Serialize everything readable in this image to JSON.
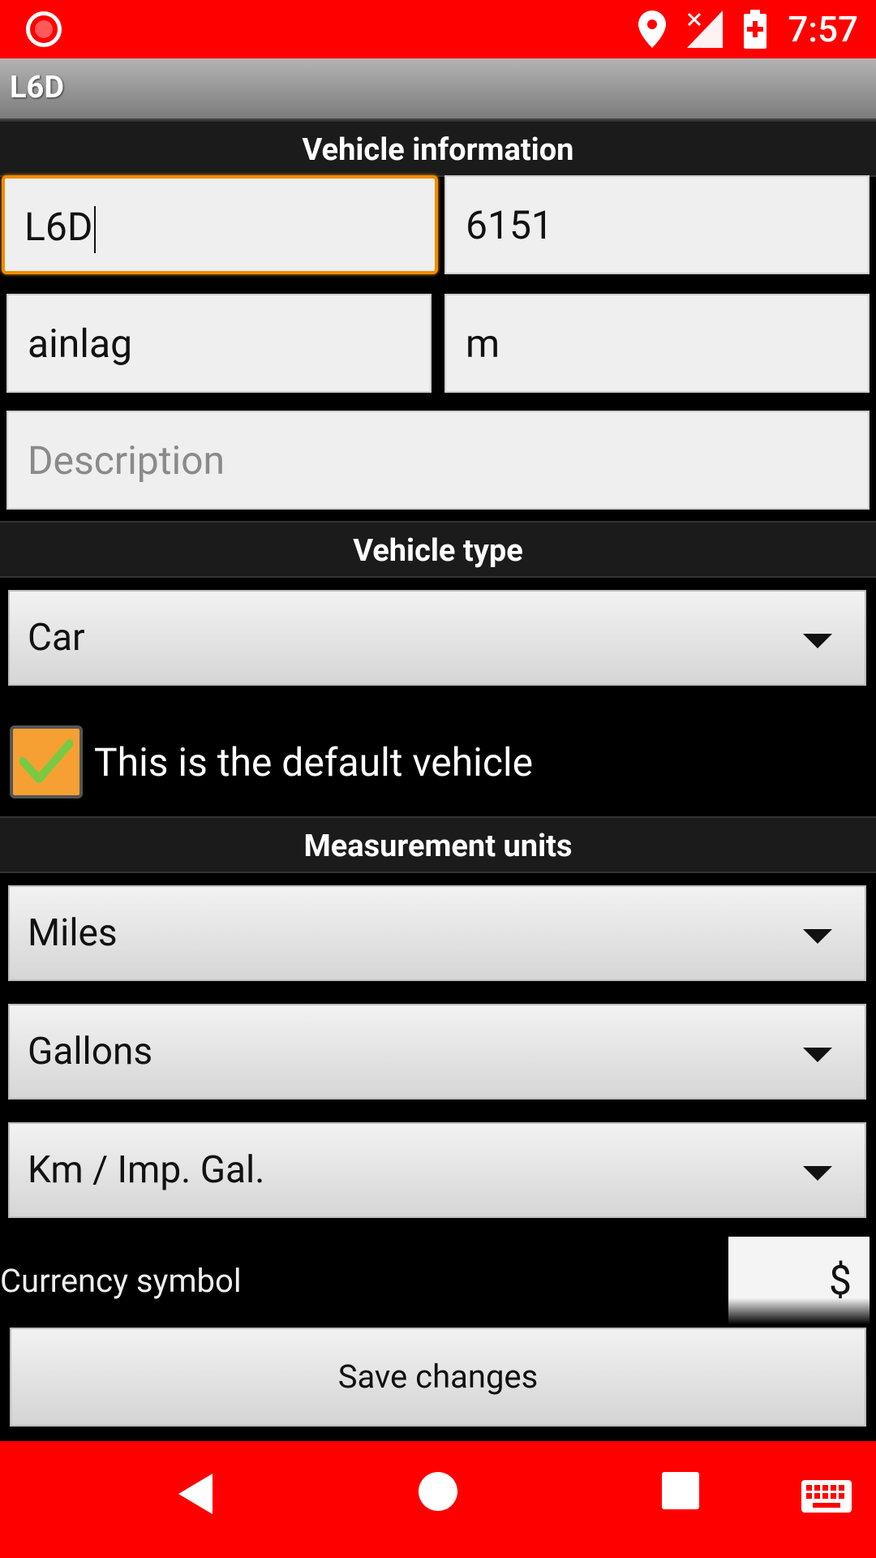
{
  "status_bar": {
    "time": "7:57",
    "icons": [
      "record-icon",
      "location-icon",
      "signal-icon",
      "battery-icon"
    ],
    "color": "#ff0000"
  },
  "app_bar": {
    "title": "L6D"
  },
  "vehicle_information": {
    "header": "Vehicle information",
    "name_value": "L6D",
    "number_value": "6151",
    "make_value": "ainlag",
    "model_value": "m",
    "description_placeholder": "Description"
  },
  "vehicle_type": {
    "header": "Vehicle type",
    "selected": "Car"
  },
  "default_vehicle": {
    "label": "This is the default vehicle",
    "checked": true
  },
  "measurement_units": {
    "header": "Measurement units",
    "distance_unit": "Miles",
    "volume_unit": "Gallons",
    "consumption_unit": "Km / Imp. Gal."
  },
  "currency": {
    "label": "Currency symbol",
    "value": "$"
  },
  "actions": {
    "save_label": "Save changes"
  },
  "nav_bar": {
    "icons": [
      "back-icon",
      "home-icon",
      "recent-apps-icon",
      "keyboard-icon"
    ],
    "color": "#ff0000"
  }
}
